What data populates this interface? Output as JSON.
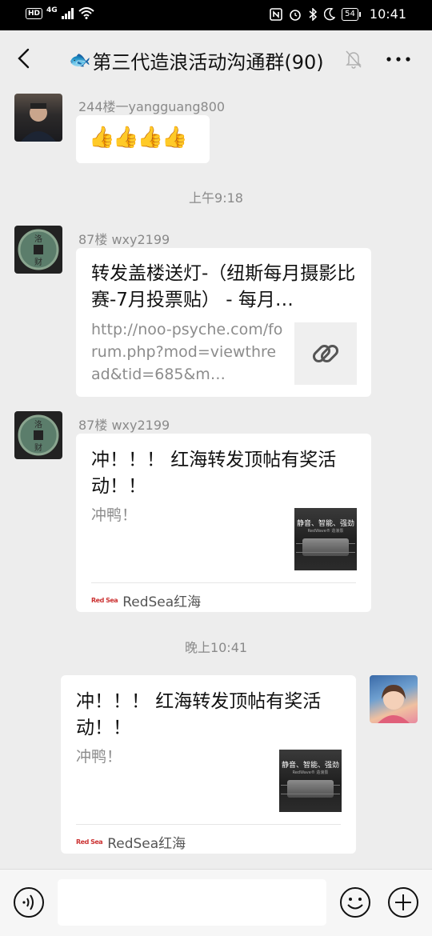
{
  "status_bar": {
    "network_badge": "HD",
    "network_type": "4G",
    "battery": "54",
    "time": "10:41"
  },
  "header": {
    "title_prefix_icon": "🐟",
    "title": "第三代造浪活动沟通群(90)",
    "icons": [
      "back-arrow-icon",
      "mute-bell-icon",
      "more-dots-icon"
    ]
  },
  "messages": [
    {
      "sender": "244楼一yangguang800",
      "content": "👍👍👍👍"
    },
    {
      "timestamp": "上午9:18"
    },
    {
      "sender": "87楼 wxy2199",
      "card": {
        "title": "转发盖楼送灯-（纽斯每月摄影比赛-7月投票贴） - 每月…",
        "desc": "http://noo-psyche.com/forum.php?mod=viewthread&tid=685&m…",
        "thumb": "link-icon"
      }
    },
    {
      "sender": "87楼 wxy2199",
      "card": {
        "title": "冲！！！ 红海转发顶帖有奖活动！！",
        "desc": "冲鸭！",
        "thumb_text": "静音、智能、强劲",
        "thumb_sub": "RedWave® 造浪泵",
        "source_logo": "Red Sea",
        "source": "RedSea红海"
      }
    },
    {
      "timestamp": "晚上10:41"
    },
    {
      "sender": "me",
      "card": {
        "title": "冲！！！ 红海转发顶帖有奖活动！！",
        "desc": "冲鸭！",
        "thumb_text": "静音、智能、强劲",
        "thumb_sub": "RedWave® 造浪泵",
        "source_logo": "Red Sea",
        "source": "RedSea红海"
      }
    }
  ],
  "colors": {
    "background": "#ededed",
    "bubble": "#ffffff",
    "meta_text": "#8a8a8a",
    "status_bar": "#000000"
  }
}
